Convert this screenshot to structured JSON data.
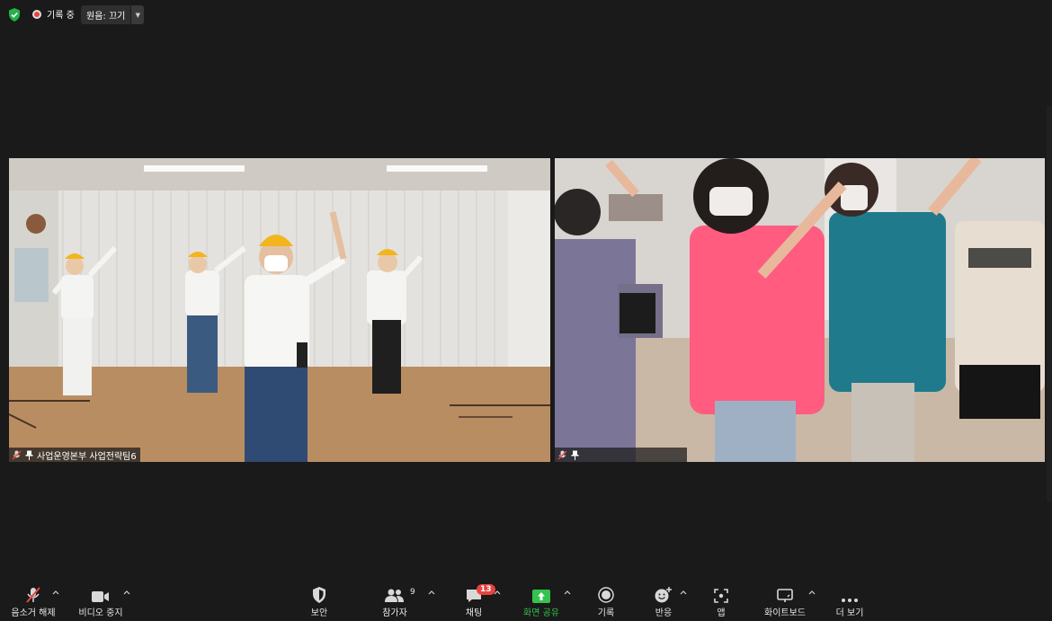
{
  "topbar": {
    "recording_label": "기록 중",
    "original_sound_label": "원음: 끄기"
  },
  "tiles": [
    {
      "name": "사업운영본부 사업전략팀6",
      "muted": true,
      "pinned": true
    },
    {
      "name": "",
      "muted": true,
      "pinned": true
    }
  ],
  "toolbar": {
    "mute": "음소거 해제",
    "video": "비디오 중지",
    "security": "보안",
    "participants": "참가자",
    "participants_count": "9",
    "chat": "채팅",
    "chat_badge": "13",
    "share": "화면 공유",
    "record": "기록",
    "reactions": "반응",
    "apps": "앱",
    "whiteboard": "화이트보드",
    "more": "더 보기"
  },
  "colors": {
    "background": "#1a1a1a",
    "accent_green": "#35c24f",
    "badge_red": "#e8433d"
  }
}
